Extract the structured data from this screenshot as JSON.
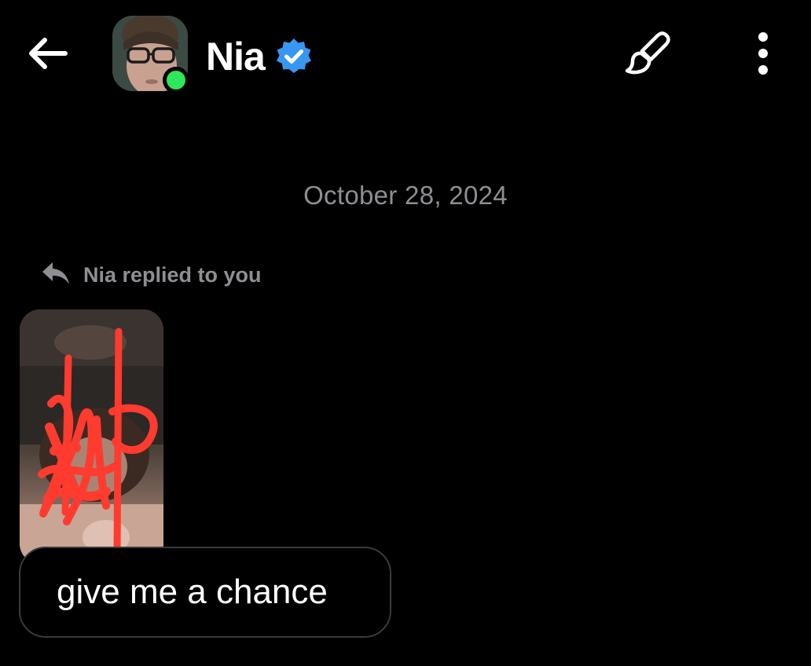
{
  "header": {
    "contact_name": "Nia",
    "verified": true,
    "online": true,
    "icons": {
      "back": "arrow-left-icon",
      "verified": "verified-badge-icon",
      "theme": "paintbrush-icon",
      "more": "more-vertical-icon"
    }
  },
  "conversation": {
    "date_separator": "October 28, 2024",
    "reply_label": "Nia replied to you",
    "reply_icon": "reply-arrow-icon",
    "message_text": "give me a chance"
  },
  "colors": {
    "background": "#000000",
    "muted_text": "#8e8e93",
    "online_green": "#2ee65a",
    "verified_blue": "#3897f0",
    "bubble_border": "#3a3a3c",
    "scribble_red": "#ff3b30"
  }
}
